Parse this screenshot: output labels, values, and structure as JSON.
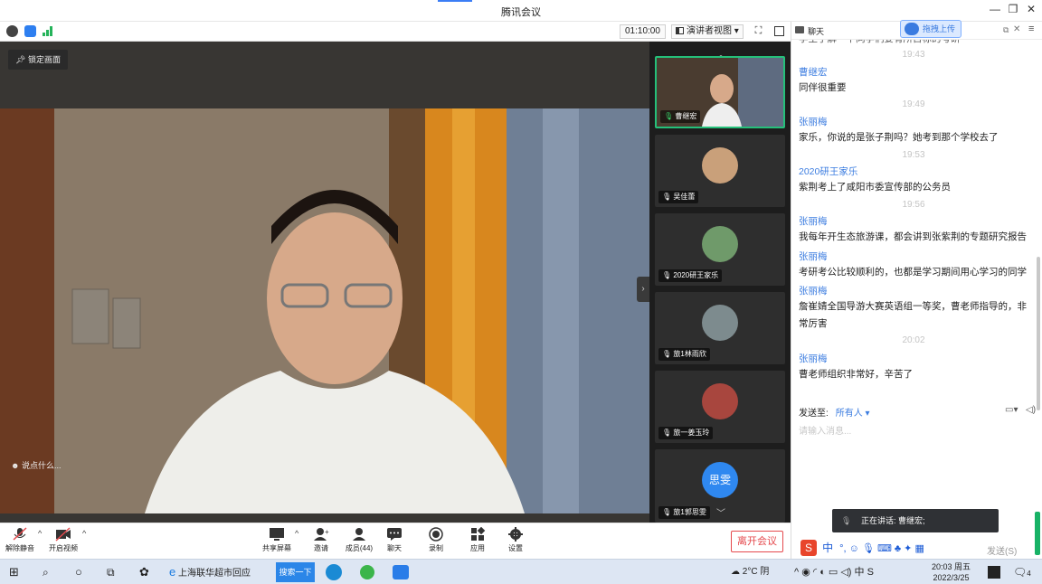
{
  "window": {
    "title": "腾讯会议",
    "controls": [
      "—",
      "❐",
      "✕"
    ]
  },
  "toolbar": {
    "timer": "01:10:00",
    "view_mode": "演讲者视图",
    "view_arrow": "▾"
  },
  "stage": {
    "lock_label": "锁定画面",
    "say_label": "说点什么..."
  },
  "participants": [
    {
      "name": "曹继宏",
      "active": true
    },
    {
      "name": "吴佳蕾"
    },
    {
      "name": "2020研王家乐"
    },
    {
      "name": "旅1林雨欣"
    },
    {
      "name": "旅一姜玉玲"
    },
    {
      "name": "旅1郭思雯",
      "avatar_text": "思雯"
    }
  ],
  "controls": {
    "unmute": "解除静音",
    "video": "开启视频",
    "share": "共享屏幕",
    "invite": "邀请",
    "members": "成员(44)",
    "chat": "聊天",
    "record": "录制",
    "apps": "应用",
    "settings": "设置",
    "leave": "离开会议"
  },
  "chat": {
    "header": "聊天",
    "upload": "拖拽上传",
    "top_clip": "学生了解一下同学们要有所目标的考研",
    "messages": [
      {
        "time": "19:43"
      },
      {
        "name": "曹继宏",
        "text": "同伴很重要"
      },
      {
        "time": "19:49"
      },
      {
        "name": "张丽梅",
        "text": "家乐，你说的是张子荆吗？她考到那个学校去了"
      },
      {
        "time": "19:53"
      },
      {
        "name": "2020研王家乐",
        "text": "紫荆考上了咸阳市委宣传部的公务员"
      },
      {
        "time": "19:56"
      },
      {
        "name": "张丽梅",
        "text": "我每年开生态旅游课，都会讲到张紫荆的专题研究报告"
      },
      {
        "name": "张丽梅",
        "text": "考研考公比较顺利的，也都是学习期间用心学习的同学"
      },
      {
        "name": "张丽梅",
        "text": "詹崔婧全国导游大赛英语组一等奖，曹老师指导的，非常厉害"
      },
      {
        "time": "20:02"
      },
      {
        "name": "张丽梅",
        "text": "曹老师组织非常好，辛苦了"
      }
    ],
    "send_to_label": "发送至:",
    "send_to_value": "所有人 ▾",
    "input_placeholder": "请输入消息...",
    "send_button": "发送(S)",
    "speaking": "正在讲话: 曹继宏;"
  },
  "taskbar": {
    "app_label": "上海联华超市回应",
    "search": "搜索一下",
    "weather": "2°C 阴",
    "time": "20:03 周五",
    "date": "2022/3/25",
    "ime": "中",
    "notif_count": "4"
  },
  "colors": {
    "accent": "#3c7de0",
    "leave": "#e5494d",
    "active_border": "#25c07a"
  }
}
